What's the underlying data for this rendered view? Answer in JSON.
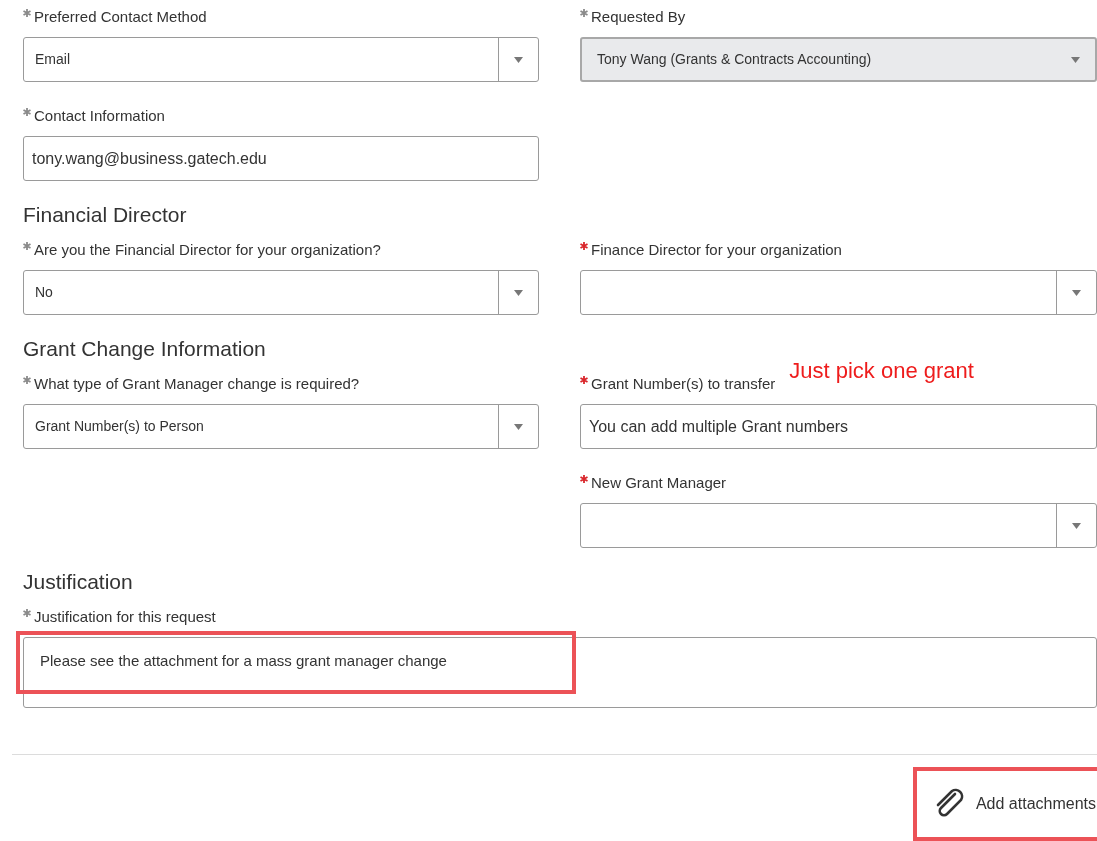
{
  "sections": [
    {
      "rows": [
        {
          "left": {
            "kind": "select",
            "label": "Preferred Contact Method",
            "error": false,
            "value": "Email",
            "disabled": false
          },
          "right": {
            "kind": "select",
            "label": "Requested By",
            "error": false,
            "value": "Tony Wang (Grants & Contracts Accounting)",
            "disabled": true
          }
        },
        {
          "left": {
            "kind": "text",
            "label": "Contact Information",
            "error": false,
            "value": "tony.wang@business.gatech.edu",
            "disabled": false
          }
        }
      ]
    },
    {
      "heading": "Financial Director",
      "rows": [
        {
          "left": {
            "kind": "select",
            "label": "Are you the Financial Director for your organization?",
            "error": false,
            "value": "No",
            "disabled": false
          },
          "right": {
            "kind": "select",
            "label": "Finance Director for your organization",
            "error": true,
            "disabled": false
          }
        }
      ]
    },
    {
      "heading": "Grant Change Information",
      "rows": [
        {
          "left": {
            "kind": "select",
            "label": "What type of Grant Manager change is required?",
            "error": false,
            "value": "Grant Number(s) to Person",
            "disabled": false
          },
          "right": {
            "kind": "text",
            "label": "Grant Number(s) to transfer",
            "error": true,
            "value": "You can add multiple Grant numbers",
            "disabled": false,
            "note": "Just pick one grant"
          }
        },
        {
          "right": {
            "kind": "select",
            "label": "New Grant Manager",
            "error": true,
            "disabled": false
          }
        }
      ]
    },
    {
      "heading": "Justification",
      "rows": [
        {
          "full": {
            "kind": "textarea",
            "label": "Justification for this request",
            "error": false,
            "value": "Please see the attachment for a mass grant manager change",
            "disabled": false,
            "highlighted": true
          }
        }
      ]
    }
  ],
  "attachment_button": {
    "label": "Add attachments",
    "highlighted": true
  }
}
